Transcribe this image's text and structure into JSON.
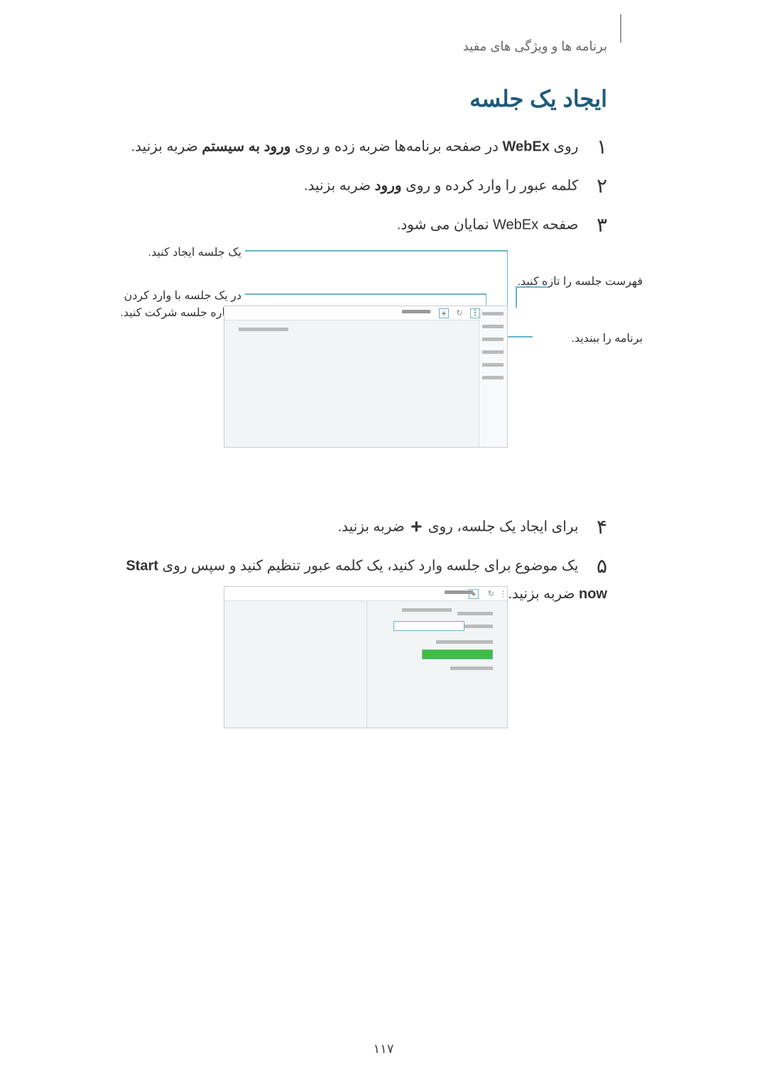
{
  "header": "برنامه ها و ویژگی های مفید",
  "title": "ایجاد یک جلسه",
  "steps": {
    "s1_num": "۱",
    "s1_text_a": "روی ",
    "s1_bold1": "WebEx",
    "s1_text_b": " در صفحه برنامه‌ها ضربه زده و روی ",
    "s1_bold2": "ورود به سیستم",
    "s1_text_c": " ضربه بزنید.",
    "s2_num": "۲",
    "s2_text_a": "کلمه عبور را وارد کرده و روی ",
    "s2_bold1": "ورود",
    "s2_text_b": " ضربه بزنید.",
    "s3_num": "۳",
    "s3_text": "صفحه WebEx نمایان می شود.",
    "s4_num": "۴",
    "s4_text_a": "برای ایجاد یک جلسه، روی ",
    "s4_text_b": " ضربه بزنید.",
    "s5_num": "۵",
    "s5_text_a": "یک موضوع برای جلسه وارد کنید، یک کلمه عبور تنظیم کنید و سپس روی ",
    "s5_bold1": "Start now",
    "s5_text_b": " ضربه بزنید."
  },
  "callouts": {
    "create": "یک جلسه ایجاد کنید.",
    "join": "در یک جلسه با وارد کردن شماره جلسه شرکت کنید.",
    "refresh": "فهرست جلسه را تازه کنید.",
    "close": "برنامه را ببندید."
  },
  "pagenum": "۱۱۷"
}
